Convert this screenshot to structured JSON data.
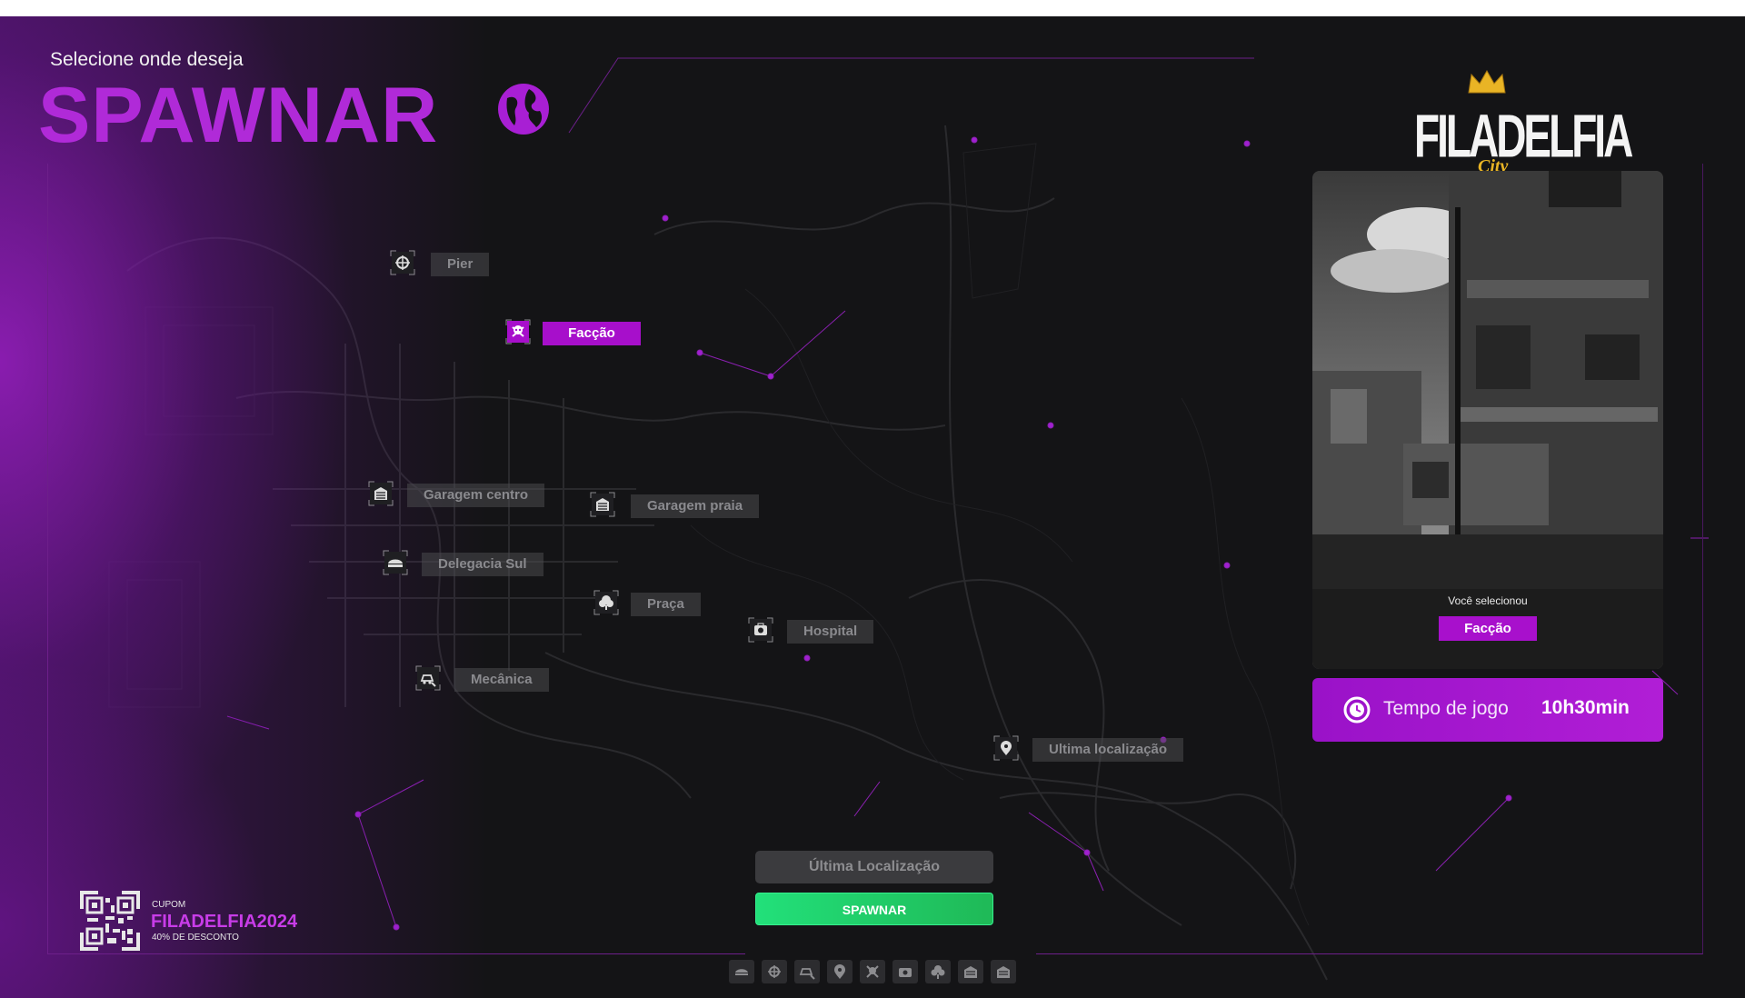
{
  "header": {
    "subtitle": "Selecione onde deseja",
    "title": "SPAWNAR"
  },
  "logo": {
    "name": "FILADELFIA",
    "sub": "City"
  },
  "locations": [
    {
      "label": "Pier",
      "icon": "ship-wheel-icon",
      "active": false
    },
    {
      "label": "Facção",
      "icon": "skull-icon",
      "active": true
    },
    {
      "label": "Garagem centro",
      "icon": "garage-icon",
      "active": false
    },
    {
      "label": "Garagem praia",
      "icon": "garage-icon",
      "active": false
    },
    {
      "label": "Delegacia Sul",
      "icon": "police-cap-icon",
      "active": false
    },
    {
      "label": "Praça",
      "icon": "tree-icon",
      "active": false
    },
    {
      "label": "Hospital",
      "icon": "medkit-icon",
      "active": false
    },
    {
      "label": "Mecânica",
      "icon": "car-repair-icon",
      "active": false
    },
    {
      "label": "Ultima localização",
      "icon": "map-pin-icon",
      "active": false
    }
  ],
  "selection": {
    "label": "Você selecionou",
    "value": "Facção"
  },
  "playtime": {
    "label": "Tempo de jogo",
    "value": "10h30min"
  },
  "actions": {
    "last_location": "Última Localização",
    "spawn": "SPAWNAR"
  },
  "quickbar": [
    "police-cap-icon",
    "ship-wheel-icon",
    "car-repair-icon",
    "map-pin-icon",
    "skull-icon",
    "medkit-icon",
    "tree-icon",
    "garage-icon",
    "garage-icon"
  ],
  "coupon": {
    "tag": "CUPOM",
    "code": "FILADELFIA2024",
    "description": "40% DE DESCONTO"
  },
  "colors": {
    "accent": "#a70fcb",
    "spawn_green": "#22d070",
    "background": "#141416"
  }
}
